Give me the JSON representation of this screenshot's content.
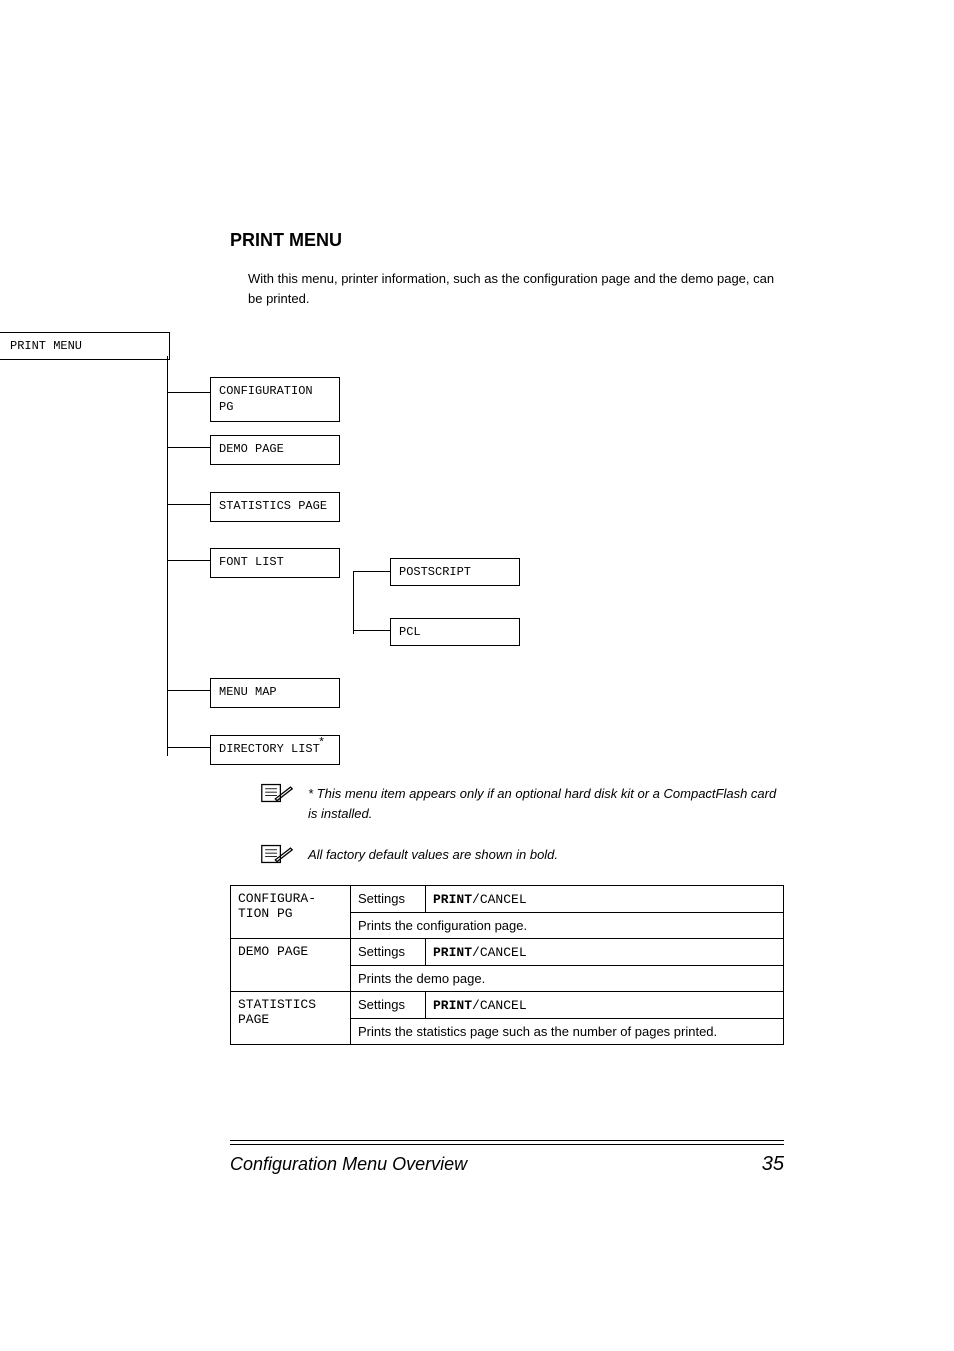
{
  "heading": "PRINT MENU",
  "intro": "With this menu, printer information, such as the configuration page and the demo page, can be printed.",
  "tree": {
    "root": "PRINT MENU",
    "items": [
      "CONFIGURATION PG",
      "DEMO PAGE",
      "STATISTICS PAGE",
      "FONT LIST",
      "MENU MAP",
      "DIRECTORY LIST"
    ],
    "font_list_children": [
      "POSTSCRIPT",
      "PCL"
    ],
    "asterisk": "*"
  },
  "notes": [
    "* This menu item appears only if an optional hard disk kit or a CompactFlash card is installed.",
    "All factory default values are shown in bold."
  ],
  "table": {
    "settings_label": "Settings",
    "print_label": "PRINT",
    "cancel_label": "CANCEL",
    "slash": "/",
    "rows": [
      {
        "name_l1": "CONFIGURA-",
        "name_l2": "TION PG",
        "desc": "Prints the configuration page."
      },
      {
        "name_l1": "DEMO PAGE",
        "name_l2": "",
        "desc": "Prints the demo page."
      },
      {
        "name_l1": "STATISTICS",
        "name_l2": "PAGE",
        "desc": "Prints the statistics page such as the number of pages printed."
      }
    ]
  },
  "footer": {
    "title": "Configuration Menu Overview",
    "page": "35"
  }
}
